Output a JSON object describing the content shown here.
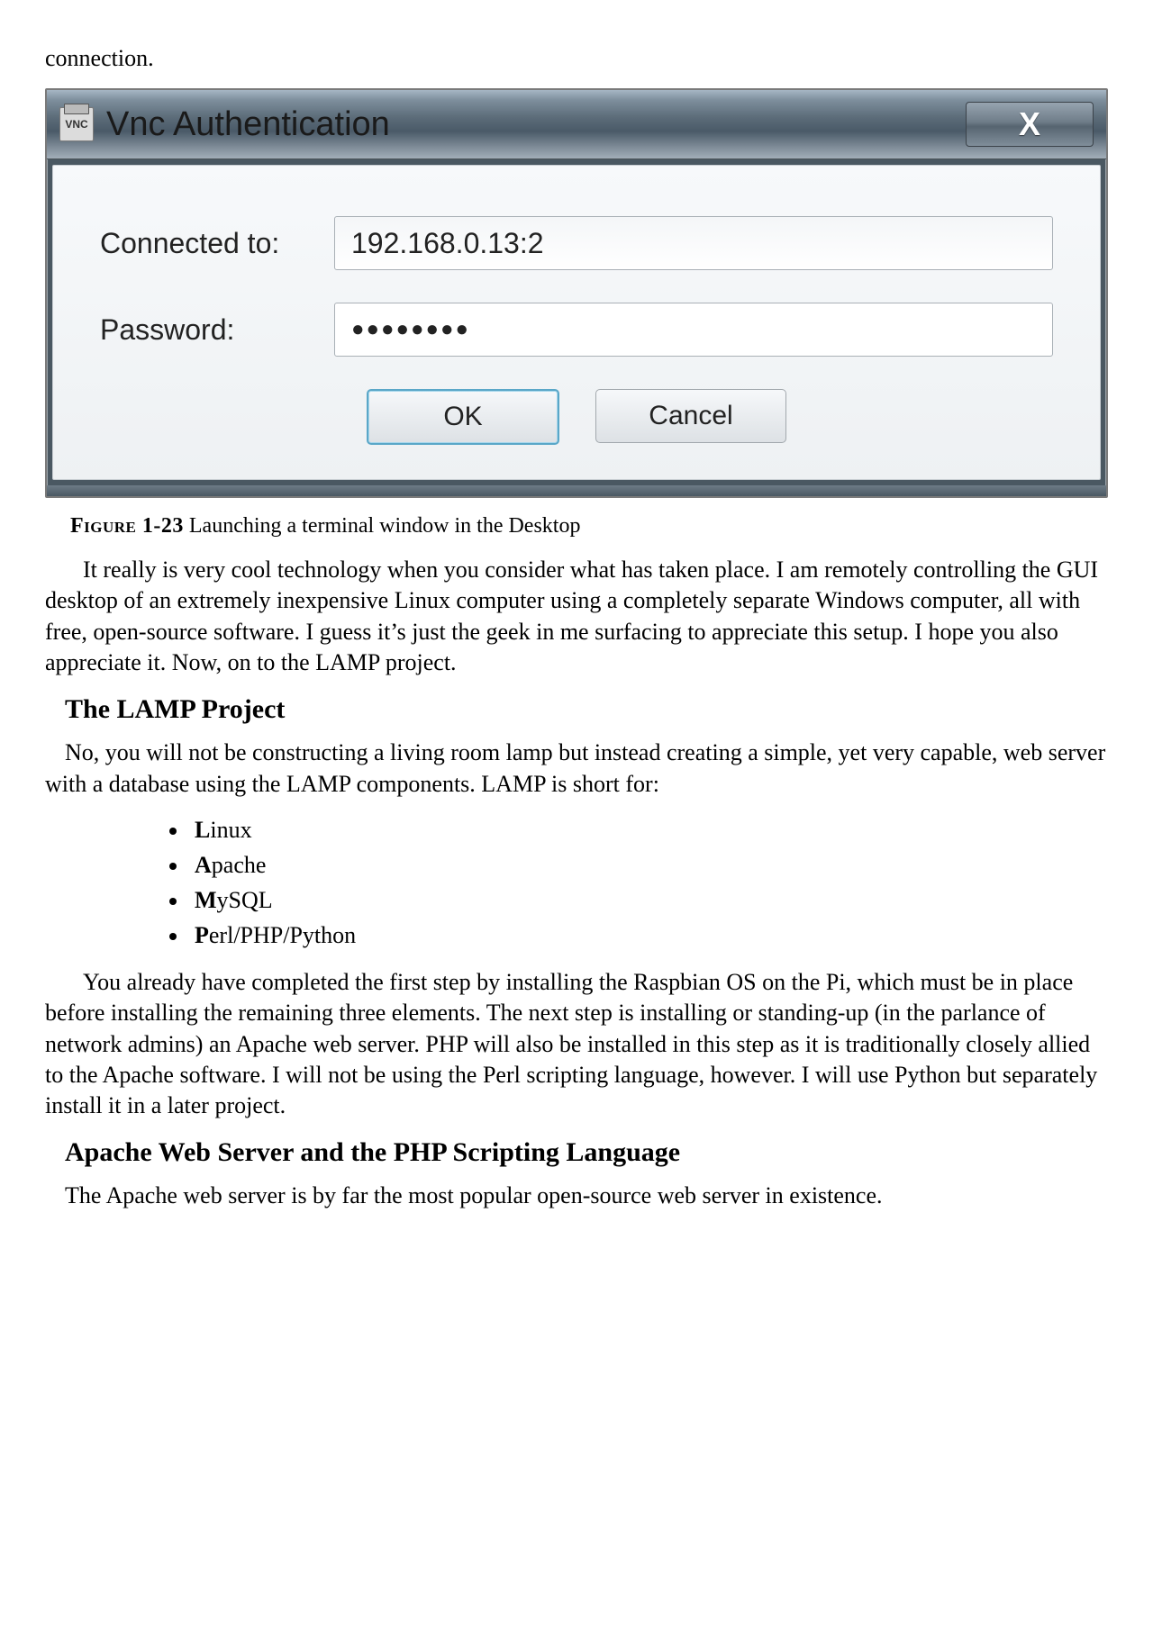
{
  "lead": "connection.",
  "dialog": {
    "title": "Vnc Authentication",
    "icon_text": "VNC",
    "close_glyph": "X",
    "fields": {
      "connected_label": "Connected to:",
      "connected_value": "192.168.0.13:2",
      "password_label": "Password:",
      "password_mask": "●●●●●●●●"
    },
    "buttons": {
      "ok": "OK",
      "cancel": "Cancel"
    }
  },
  "caption": {
    "figure_label": "Figure 1-23",
    "figure_text": " Launching a terminal window in the Desktop"
  },
  "para1": "It really is very cool technology when you consider what has taken place. I am remotely controlling the GUI desktop of an extremely inexpensive Linux computer using a completely separate Windows computer, all with free, open-source software. I guess it’s just the geek in me surfacing to appreciate this setup. I hope you also appreciate it. Now, on to the LAMP project.",
  "heading_lamp": "The LAMP Project",
  "para2": "No, you will not be constructing a living room lamp but instead creating a simple, yet very capable, web server with a database using the LAMP components. LAMP is short for:",
  "lamp_items": [
    {
      "bold": "L",
      "rest": "inux"
    },
    {
      "bold": "A",
      "rest": "pache"
    },
    {
      "bold": "M",
      "rest": "ySQL"
    },
    {
      "bold": "P",
      "rest": "erl/PHP/Python"
    }
  ],
  "para3": "You already have completed the first step by installing the Raspbian OS on the Pi, which must be in place before installing the remaining three elements. The next step is installing or standing-up (in the parlance of network admins) an Apache web server. PHP will also be installed in this step as it is traditionally closely allied to the Apache software. I will not be using the Perl scripting language, however. I will use Python but separately install it in a later project.",
  "heading_apache": "Apache Web Server and the PHP Scripting Language",
  "para4": "The Apache web server is by far the most popular open-source web server in existence."
}
